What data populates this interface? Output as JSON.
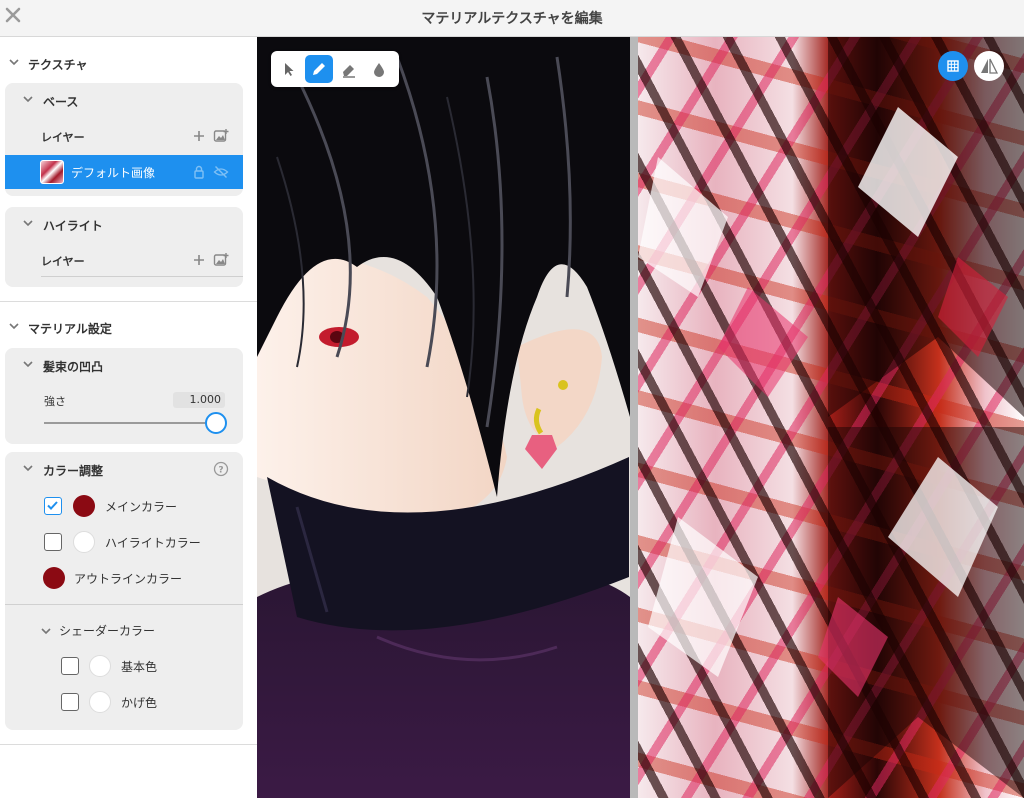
{
  "window": {
    "title": "マテリアルテクスチャを編集"
  },
  "texture_section": {
    "title": "テクスチャ",
    "base": {
      "title": "ベース",
      "layers_label": "レイヤー",
      "selected_layer": "デフォルト画像"
    },
    "highlight": {
      "title": "ハイライト",
      "layers_label": "レイヤー"
    }
  },
  "material_section": {
    "title": "マテリアル設定",
    "bump": {
      "title": "髪束の凹凸",
      "strength_label": "強さ",
      "strength_value": "1.000",
      "strength_fraction": 1.0
    },
    "color_adjust": {
      "title": "カラー調整",
      "main_color": {
        "label": "メインカラー",
        "checked": true,
        "color": "#8b0a13"
      },
      "highlight_color": {
        "label": "ハイライトカラー",
        "checked": false,
        "color": "#ffffff"
      },
      "outline_color": {
        "label": "アウトラインカラー",
        "color": "#8b0a13"
      },
      "shader_color": {
        "title": "シェーダーカラー",
        "base_color": {
          "label": "基本色",
          "checked": false,
          "color": "#ffffff"
        },
        "shade_color": {
          "label": "かげ色",
          "checked": false,
          "color": "#ffffff"
        }
      }
    }
  },
  "colors": {
    "accent": "#1e90ef"
  },
  "icons": {
    "close": "close-icon",
    "add": "plus-icon",
    "add_image": "add-image-icon",
    "lock": "lock-icon",
    "hidden": "eye-off-icon",
    "help": "help-icon",
    "grid": "grid-icon",
    "mirror": "mirror-icon",
    "select": "cursor-icon",
    "pen": "pen-icon",
    "eraser": "eraser-icon",
    "fill": "drop-icon"
  }
}
